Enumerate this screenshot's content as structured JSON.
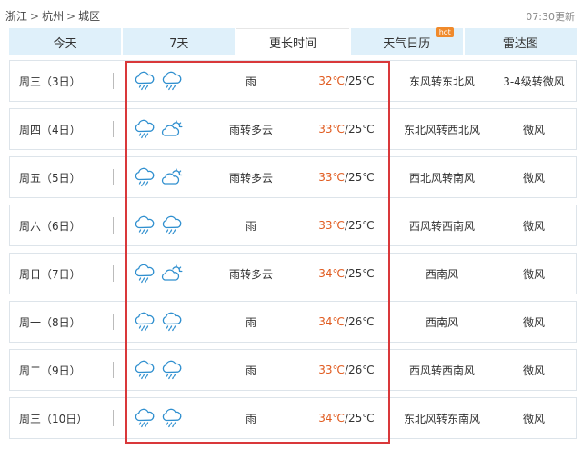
{
  "breadcrumb": {
    "province": "浙江",
    "city": "杭州",
    "district": "城区",
    "separator": ">"
  },
  "update_time": "07:30更新",
  "tabs": [
    {
      "label": "今天"
    },
    {
      "label": "7天"
    },
    {
      "label": "更长时间"
    },
    {
      "label": "天气日历",
      "badge": "hot"
    },
    {
      "label": "雷达图"
    }
  ],
  "active_tab": "更长时间",
  "forecast": [
    {
      "day": "周三（3日）",
      "icons": [
        "rain-icon",
        "rain-icon"
      ],
      "desc": "雨",
      "high": "32℃",
      "low": "/25℃",
      "wind": "东风转东北风",
      "level": "3-4级转微风"
    },
    {
      "day": "周四（4日）",
      "icons": [
        "rain-icon",
        "partly-cloudy-icon"
      ],
      "desc": "雨转多云",
      "high": "33℃",
      "low": "/25℃",
      "wind": "东北风转西北风",
      "level": "微风"
    },
    {
      "day": "周五（5日）",
      "icons": [
        "rain-icon",
        "partly-cloudy-icon"
      ],
      "desc": "雨转多云",
      "high": "33℃",
      "low": "/25℃",
      "wind": "西北风转南风",
      "level": "微风"
    },
    {
      "day": "周六（6日）",
      "icons": [
        "rain-icon",
        "rain-icon"
      ],
      "desc": "雨",
      "high": "33℃",
      "low": "/25℃",
      "wind": "西风转西南风",
      "level": "微风"
    },
    {
      "day": "周日（7日）",
      "icons": [
        "rain-icon",
        "partly-cloudy-icon"
      ],
      "desc": "雨转多云",
      "high": "34℃",
      "low": "/25℃",
      "wind": "西南风",
      "level": "微风"
    },
    {
      "day": "周一（8日）",
      "icons": [
        "rain-icon",
        "rain-icon"
      ],
      "desc": "雨",
      "high": "34℃",
      "low": "/26℃",
      "wind": "西南风",
      "level": "微风"
    },
    {
      "day": "周二（9日）",
      "icons": [
        "rain-icon",
        "rain-icon"
      ],
      "desc": "雨",
      "high": "33℃",
      "low": "/26℃",
      "wind": "西风转西南风",
      "level": "微风"
    },
    {
      "day": "周三（10日）",
      "icons": [
        "rain-icon",
        "rain-icon"
      ],
      "desc": "雨",
      "high": "34℃",
      "low": "/25℃",
      "wind": "东北风转东南风",
      "level": "微风"
    }
  ],
  "colors": {
    "tab_bg": "#dff0fa",
    "high_temp": "#e05a1e",
    "highlight_box": "#d9383a",
    "icon_stroke": "#2f8fcf"
  }
}
